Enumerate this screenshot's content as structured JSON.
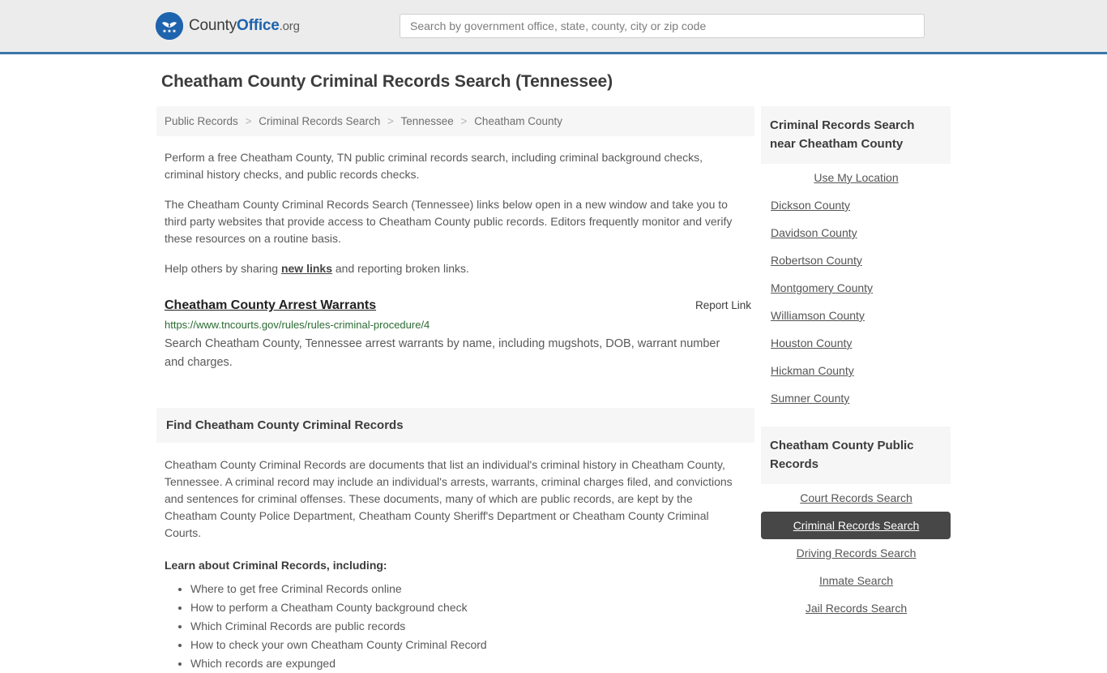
{
  "header": {
    "brand": {
      "part1": "County",
      "part2": "Office",
      "part3": ".org",
      "logo_icon": "eagle-stars-icon"
    },
    "search": {
      "placeholder": "Search by government office, state, county, city or zip code",
      "value": ""
    }
  },
  "page": {
    "title": "Cheatham County Criminal Records Search (Tennessee)"
  },
  "breadcrumb": {
    "separator": ">",
    "items": [
      {
        "label": "Public Records"
      },
      {
        "label": "Criminal Records Search"
      },
      {
        "label": "Tennessee"
      },
      {
        "label": "Cheatham County"
      }
    ]
  },
  "intro": {
    "p1": "Perform a free Cheatham County, TN public criminal records search, including criminal background checks, criminal history checks, and public records checks.",
    "p2": "The Cheatham County Criminal Records Search (Tennessee) links below open in a new window and take you to third party websites that provide access to Cheatham County public records. Editors frequently monitor and verify these resources on a routine basis.",
    "p3_before": "Help others by sharing ",
    "p3_link": "new links",
    "p3_after": " and reporting broken links."
  },
  "result": {
    "title": "Cheatham County Arrest Warrants",
    "report_label": "Report Link",
    "url": "https://www.tncourts.gov/rules/rules-criminal-procedure/4",
    "description": "Search Cheatham County, Tennessee arrest warrants by name, including mugshots, DOB, warrant number and charges."
  },
  "section": {
    "heading": "Find Cheatham County Criminal Records",
    "body": "Cheatham County Criminal Records are documents that list an individual's criminal history in Cheatham County, Tennessee. A criminal record may include an individual's arrests, warrants, criminal charges filed, and convictions and sentences for criminal offenses. These documents, many of which are public records, are kept by the Cheatham County Police Department, Cheatham County Sheriff's Department or Cheatham County Criminal Courts.",
    "learn_heading": "Learn about Criminal Records, including:",
    "learn_items": [
      "Where to get free Criminal Records online",
      "How to perform a Cheatham County background check",
      "Which Criminal Records are public records",
      "How to check your own Cheatham County Criminal Record",
      "Which records are expunged"
    ]
  },
  "sidebar": {
    "nearby": {
      "heading": "Criminal Records Search near Cheatham County",
      "items": [
        {
          "label": "Use My Location",
          "centered": true,
          "active": false
        },
        {
          "label": "Dickson County",
          "centered": false,
          "active": false
        },
        {
          "label": "Davidson County",
          "centered": false,
          "active": false
        },
        {
          "label": "Robertson County",
          "centered": false,
          "active": false
        },
        {
          "label": "Montgomery County",
          "centered": false,
          "active": false
        },
        {
          "label": "Williamson County",
          "centered": false,
          "active": false
        },
        {
          "label": "Houston County",
          "centered": false,
          "active": false
        },
        {
          "label": "Hickman County",
          "centered": false,
          "active": false
        },
        {
          "label": "Sumner County",
          "centered": false,
          "active": false
        }
      ]
    },
    "public_records": {
      "heading": "Cheatham County Public Records",
      "items": [
        {
          "label": "Court Records Search",
          "centered": true,
          "active": false
        },
        {
          "label": "Criminal Records Search",
          "centered": true,
          "active": true
        },
        {
          "label": "Driving Records Search",
          "centered": true,
          "active": false
        },
        {
          "label": "Inmate Search",
          "centered": true,
          "active": false
        },
        {
          "label": "Jail Records Search",
          "centered": true,
          "active": false
        }
      ]
    }
  },
  "colors": {
    "header_bg": "#ececec",
    "header_border": "#3a76a8",
    "brand_blue": "#1e63ad",
    "panel_bg": "#f6f6f6",
    "active_bg": "#474747",
    "url_green": "#2b6b33"
  }
}
